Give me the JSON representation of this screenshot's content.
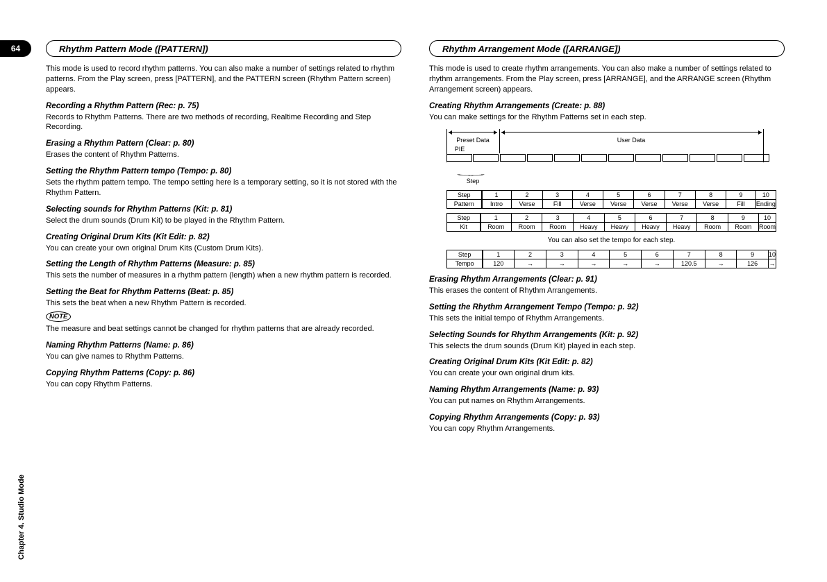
{
  "page_number": "64",
  "chapter_footer": "Chapter 4. Studio Mode",
  "left": {
    "header": "Rhythm Pattern Mode ([PATTERN])",
    "intro": "This mode is used to record rhythm patterns. You can also make a number of settings related to rhythm patterns. From the Play screen, press [PATTERN], and the PATTERN screen (Rhythm Pattern screen) appears.",
    "items": [
      {
        "title": "Recording a Rhythm Pattern (Rec: p. 75)",
        "body": "Records to Rhythm Patterns. There are two methods of recording, Realtime Recording and Step Recording."
      },
      {
        "title": "Erasing a Rhythm Pattern (Clear: p. 80)",
        "body": "Erases the content of Rhythm Patterns."
      },
      {
        "title": "Setting the Rhythm Pattern tempo (Tempo: p. 80)",
        "body": "Sets the rhythm pattern tempo. The tempo setting here is a temporary setting, so it is not stored with the Rhythm Pattern."
      },
      {
        "title": "Selecting sounds for Rhythm Patterns (Kit: p. 81)",
        "body": "Select the drum sounds (Drum Kit) to be played in the Rhythm Pattern."
      },
      {
        "title": "Creating Original Drum Kits (Kit Edit: p. 82)",
        "body": "You can create your own original Drum Kits (Custom Drum Kits)."
      },
      {
        "title": "Setting the Length of Rhythm Patterns (Measure: p. 85)",
        "body": "This sets the number of measures in a rhythm pattern (length) when a new rhythm pattern is recorded."
      },
      {
        "title": "Setting the Beat for Rhythm Patterns (Beat: p. 85)",
        "body": "This sets the beat when a new Rhythm Pattern is recorded.",
        "note": "NOTE",
        "note_body": "The measure and beat settings cannot be changed for rhythm patterns that are already recorded."
      },
      {
        "title": "Naming Rhythm Patterns (Name: p. 86)",
        "body": "You can give names to Rhythm Patterns."
      },
      {
        "title": "Copying Rhythm Patterns (Copy: p. 86)",
        "body": "You can copy Rhythm Patterns."
      }
    ]
  },
  "right": {
    "header": "Rhythm Arrangement Mode ([ARRANGE])",
    "intro": "This mode is used to create rhythm arrangements. You can also make a number of settings related to rhythm arrangements. From the Play screen, press [ARRANGE], and the ARRANGE screen (Rhythm Arrangement screen) appears.",
    "create_title": "Creating Rhythm Arrangements (Create: p. 88)",
    "create_body": "You can make settings for the Rhythm Patterns set in each step.",
    "diagram": {
      "preset_label": "Preset Data",
      "user_label": "User Data",
      "label_pie": "PIE",
      "steps_title": "Step",
      "steps": [
        "1",
        "2",
        "3",
        "4",
        "5",
        "6",
        "7",
        "8",
        "9",
        "10"
      ],
      "row_pattern_label": "Pattern",
      "row_pattern": [
        "Intro",
        "Verse",
        "Fill",
        "Verse",
        "Verse",
        "Verse",
        "Verse",
        "Verse",
        "Fill",
        "Ending"
      ],
      "row_kit_label": "Kit",
      "row_kit": [
        "Room",
        "Room",
        "Room",
        "Heavy",
        "Heavy",
        "Heavy",
        "Heavy",
        "Room",
        "Room",
        "Room"
      ],
      "divider_text": "You can also set the tempo for each step.",
      "row_tempo_label": "Tempo",
      "row_tempo": [
        "120",
        "→",
        "→",
        "→",
        "→",
        "→",
        "120.5",
        "→",
        "126",
        "→"
      ]
    },
    "items": [
      {
        "title": "Erasing Rhythm Arrangements (Clear: p. 91)",
        "body": "This erases the content of Rhythm Arrangements."
      },
      {
        "title": "Setting the Rhythm Arrangement Tempo (Tempo: p. 92)",
        "body": "This sets the initial tempo of Rhythm Arrangements."
      },
      {
        "title": "Selecting Sounds for Rhythm Arrangements (Kit: p. 92)",
        "body": "This selects the drum sounds (Drum Kit) played in each step."
      },
      {
        "title": "Creating Original Drum Kits (Kit Edit: p. 82)",
        "body": "You can create your own original drum kits."
      },
      {
        "title": "Naming Rhythm Arrangements (Name: p. 93)",
        "body": "You can put names on Rhythm Arrangements."
      },
      {
        "title": "Copying Rhythm Arrangements (Copy: p. 93)",
        "body": "You can copy Rhythm Arrangements."
      }
    ]
  }
}
